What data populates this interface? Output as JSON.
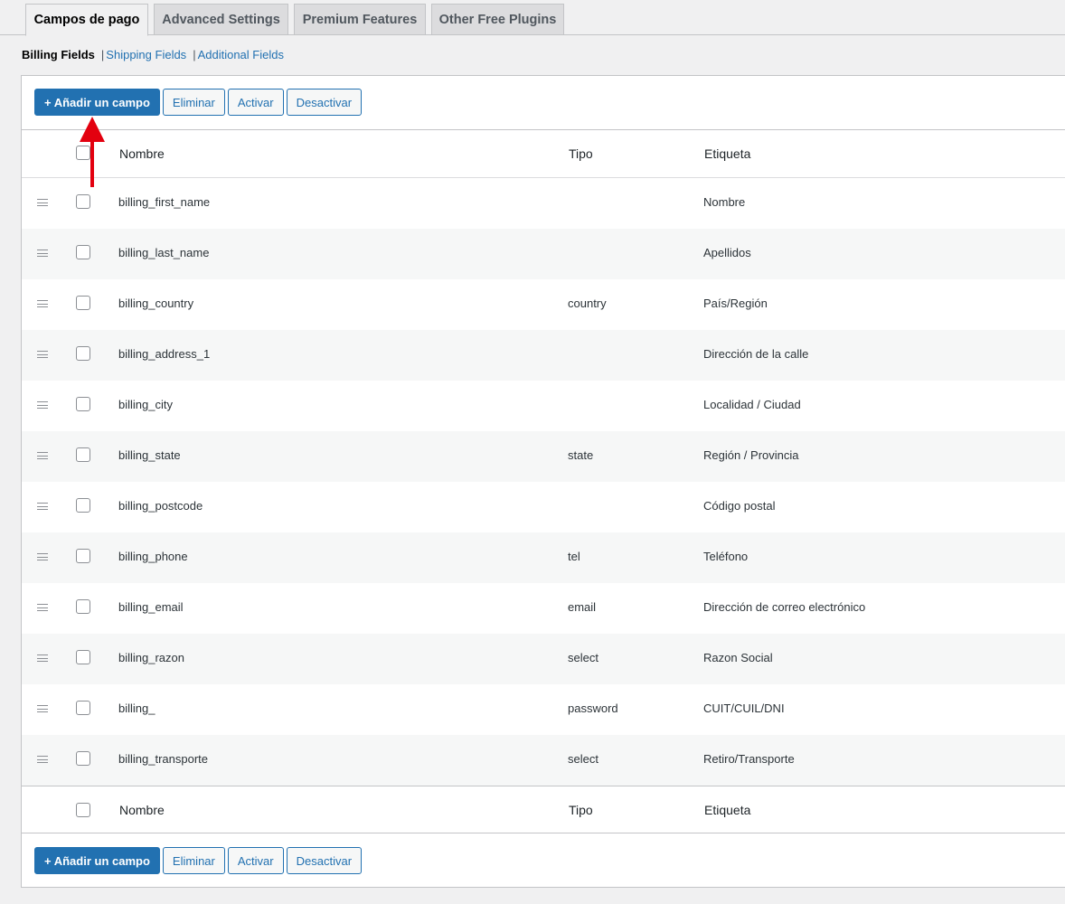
{
  "tabs": [
    "Campos de pago",
    "Advanced Settings",
    "Premium Features",
    "Other Free Plugins"
  ],
  "subnav": {
    "current": "Billing Fields",
    "separator": "|",
    "links": [
      "Shipping Fields",
      "Additional Fields"
    ]
  },
  "actions": {
    "add": "+ Añadir un campo",
    "remove": "Eliminar",
    "enable": "Activar",
    "disable": "Desactivar"
  },
  "columns": {
    "name": "Nombre",
    "type": "Tipo",
    "label": "Etiqueta"
  },
  "rows": [
    {
      "name": "billing_first_name",
      "type": "",
      "label": "Nombre"
    },
    {
      "name": "billing_last_name",
      "type": "",
      "label": "Apellidos"
    },
    {
      "name": "billing_country",
      "type": "country",
      "label": "País/Región"
    },
    {
      "name": "billing_address_1",
      "type": "",
      "label": "Dirección de la calle"
    },
    {
      "name": "billing_city",
      "type": "",
      "label": "Localidad / Ciudad"
    },
    {
      "name": "billing_state",
      "type": "state",
      "label": "Región / Provincia"
    },
    {
      "name": "billing_postcode",
      "type": "",
      "label": "Código postal"
    },
    {
      "name": "billing_phone",
      "type": "tel",
      "label": "Teléfono"
    },
    {
      "name": "billing_email",
      "type": "email",
      "label": "Dirección de correo electrónico"
    },
    {
      "name": "billing_razon",
      "type": "select",
      "label": "Razon Social"
    },
    {
      "name": "billing_",
      "type": "password",
      "label": "CUIT/CUIL/DNI"
    },
    {
      "name": "billing_transporte",
      "type": "select",
      "label": "Retiro/Transporte"
    }
  ],
  "colors": {
    "primary": "#2271b1",
    "annotation": "#e3000f"
  },
  "annotation": {
    "icon": "red-arrow-up-icon"
  }
}
